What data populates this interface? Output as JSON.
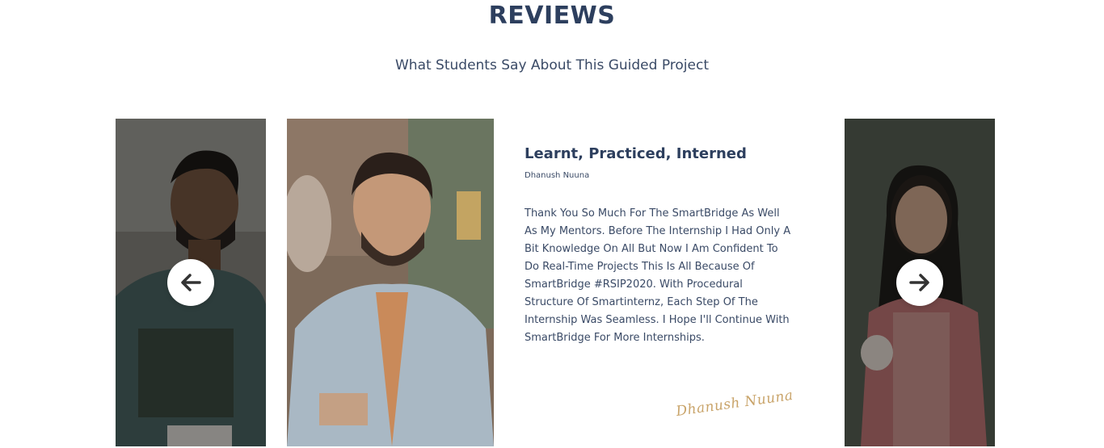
{
  "section": {
    "title": "REVIEWS",
    "subtitle": "What Students Say About This Guided Project"
  },
  "carousel": {
    "prev_icon": "arrow-left-icon",
    "next_icon": "arrow-right-icon",
    "active_review": {
      "title": "Learnt, Practiced, Interned",
      "author": "Dhanush Nuuna",
      "body": "Thank You So Much For The SmartBridge As Well As My Mentors. Before The Internship I Had Only A Bit Knowledge On All But Now I Am Confident To Do Real-Time Projects This Is All Because Of SmartBridge #RSIP2020. With Procedural Structure Of Smartinternz, Each Step Of The Internship Was Seamless. I Hope I'll Continue With SmartBridge For More Internships.",
      "signature": "Dhanush Nuuna"
    }
  },
  "colors": {
    "heading": "#2d3f5e",
    "text": "#3a4a66",
    "signature": "#c9a46a"
  }
}
